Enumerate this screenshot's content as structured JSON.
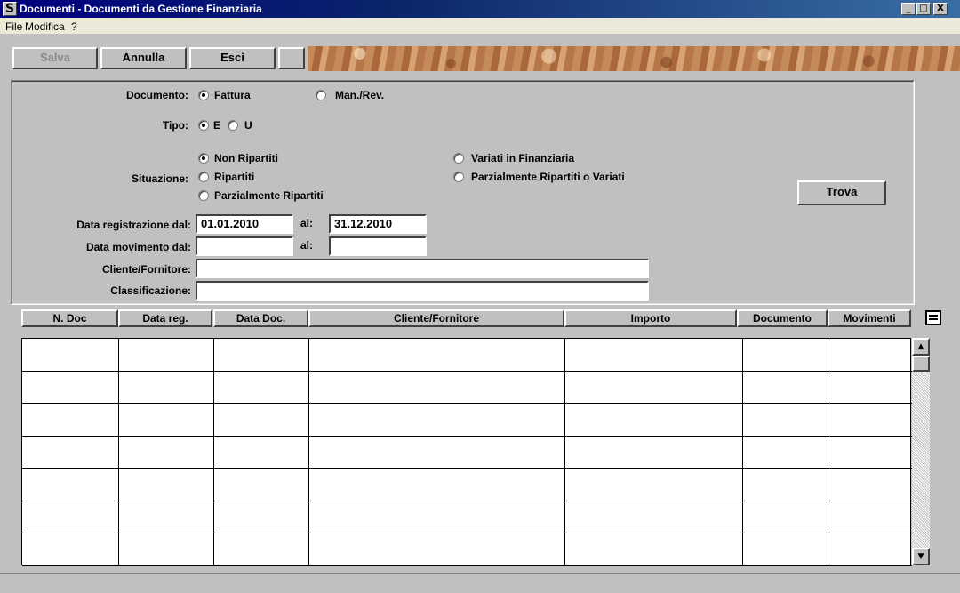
{
  "window": {
    "title": "Documenti - Documenti da Gestione Finanziaria",
    "icon_glyph": "S",
    "minimize": "_",
    "maximize": "□",
    "close": "X"
  },
  "menu": [
    "File",
    "Modifica",
    "?"
  ],
  "toolbar": {
    "save": "Salva",
    "cancel": "Annulla",
    "exit": "Esci"
  },
  "filters": {
    "documento_label": "Documento:",
    "documento_options": [
      "Fattura",
      "Man./Rev."
    ],
    "documento_selected": "Fattura",
    "tipo_label": "Tipo:",
    "tipo_options": [
      "E",
      "U"
    ],
    "tipo_selected": "E",
    "situazione_label": "Situazione:",
    "situazione_options": [
      "Non Ripartiti",
      "Ripartiti",
      "Parzialmente Ripartiti",
      "Variati in Finanziaria",
      "Parzialmente Ripartiti o Variati"
    ],
    "situazione_selected": "Non Ripartiti",
    "data_reg_label": "Data registrazione dal:",
    "data_reg_from": "01.01.2010",
    "al_label": "al:",
    "data_reg_to": "31.12.2010",
    "data_mov_label": "Data movimento dal:",
    "data_mov_from": "",
    "data_mov_to": "",
    "cliente_label": "Cliente/Fornitore:",
    "cliente_value": "",
    "class_label": "Classificazione:",
    "class_value": "",
    "find_button": "Trova"
  },
  "grid": {
    "columns": [
      "N. Doc",
      "Data reg.",
      "Data Doc.",
      "Cliente/Fornitore",
      "Importo",
      "Documento",
      "Movimenti"
    ],
    "rows": 7
  },
  "scrollbar": {
    "up": "▲",
    "down": "▼"
  }
}
